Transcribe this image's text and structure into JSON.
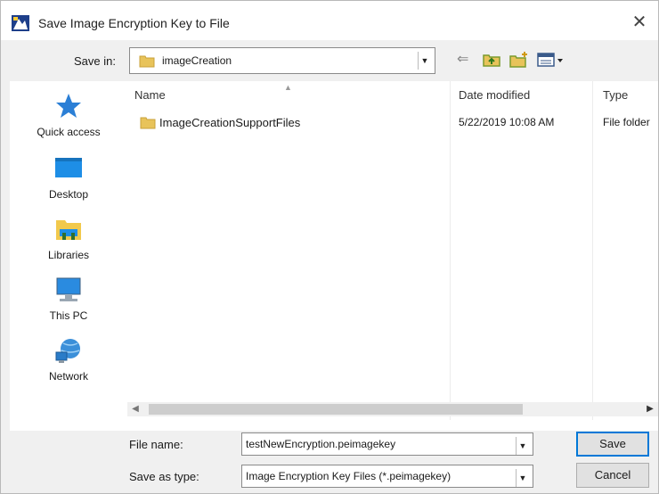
{
  "window": {
    "title": "Save Image Encryption Key to File",
    "close_glyph": "✕"
  },
  "toolbar": {
    "save_in_label": "Save in:",
    "save_in_value": "imageCreation",
    "back_glyph": "⇐"
  },
  "sidebar": {
    "items": [
      {
        "label": "Quick access",
        "icon": "star-icon"
      },
      {
        "label": "Desktop",
        "icon": "desktop-icon"
      },
      {
        "label": "Libraries",
        "icon": "libraries-icon"
      },
      {
        "label": "This PC",
        "icon": "computer-icon"
      },
      {
        "label": "Network",
        "icon": "network-icon"
      }
    ]
  },
  "file_list": {
    "columns": [
      "Name",
      "Date modified",
      "Type"
    ],
    "rows": [
      {
        "name": "ImageCreationSupportFiles",
        "date": "5/22/2019 10:08 AM",
        "type": "File folder"
      }
    ]
  },
  "form": {
    "file_name_label": "File name:",
    "file_name_value": "testNewEncryption.peimagekey",
    "save_type_label": "Save as type:",
    "save_type_value": "Image Encryption Key Files (*.peimagekey)",
    "save_button": "Save",
    "cancel_button": "Cancel"
  },
  "colors": {
    "accent": "#0078d7",
    "folder": "#e8c35a",
    "star": "#2b7fd6"
  }
}
